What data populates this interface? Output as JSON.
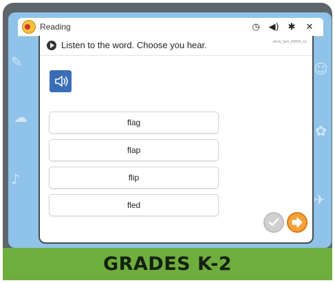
{
  "window": {
    "app_title": "Reading"
  },
  "top_actions": [
    {
      "name": "history-icon",
      "glyph": "◷"
    },
    {
      "name": "volume-icon",
      "glyph": "◀)"
    },
    {
      "name": "settings-gear-icon",
      "glyph": "✱"
    },
    {
      "name": "close-icon",
      "glyph": "✕"
    }
  ],
  "question": {
    "instruction": "Listen to the word. Choose you hear.",
    "item_id": "ahrw_lpm_t0000_s1",
    "choices": [
      "flag",
      "flap",
      "flip",
      "fled"
    ]
  },
  "footer": {
    "label": "GRADES K-2"
  },
  "colors": {
    "background_blue": "#8fc3e9",
    "speaker_button": "#3a6db6",
    "next_button": "#f4a13a",
    "footer_green": "#6fad3f"
  }
}
